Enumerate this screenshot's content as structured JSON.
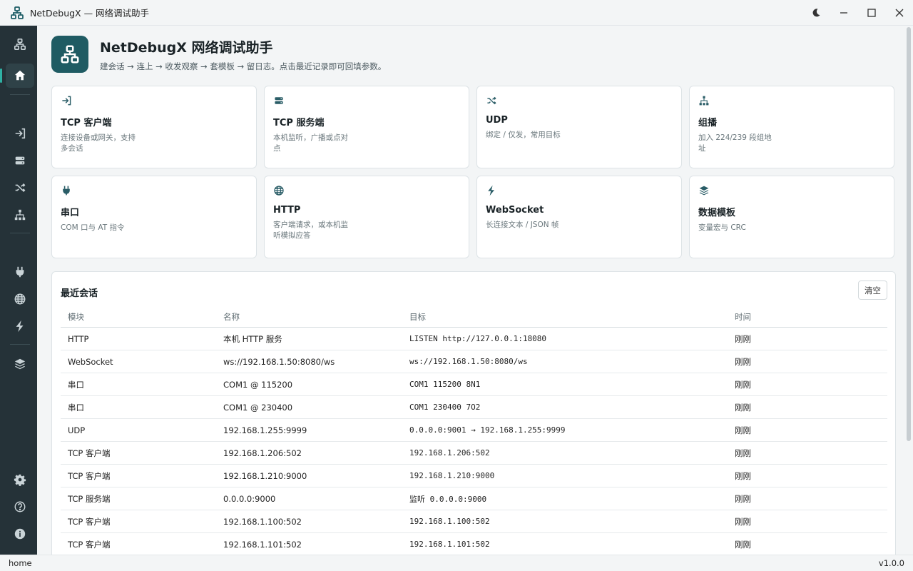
{
  "window": {
    "title": "NetDebugX — 网络调试助手"
  },
  "hero": {
    "title": "NetDebugX 网络调试助手",
    "subtitle": "建会话 → 连上 → 收发观察 → 套模板 → 留日志。点击最近记录即可回填参数。"
  },
  "cards": [
    {
      "icon": "login-arrow-icon",
      "title": "TCP 客户端",
      "desc": "连接设备或网关，支持多会话"
    },
    {
      "icon": "server-icon",
      "title": "TCP 服务端",
      "desc": "本机监听，广播或点对点"
    },
    {
      "icon": "shuffle-icon",
      "title": "UDP",
      "desc": "绑定 / 仅发，常用目标"
    },
    {
      "icon": "sitemap-icon",
      "title": "组播",
      "desc": "加入 224/239 段组地址"
    },
    {
      "icon": "plug-icon",
      "title": "串口",
      "desc": "COM 口与 AT 指令"
    },
    {
      "icon": "globe-icon",
      "title": "HTTP",
      "desc": "客户端请求，或本机监听模拟应答"
    },
    {
      "icon": "bolt-icon",
      "title": "WebSocket",
      "desc": "长连接文本 / JSON 帧"
    },
    {
      "icon": "layers-icon",
      "title": "数据模板",
      "desc": "变量宏与 CRC"
    }
  ],
  "recent": {
    "title": "最近会话",
    "clear_label": "清空",
    "columns": [
      "模块",
      "名称",
      "目标",
      "时间"
    ],
    "rows": [
      {
        "module": "HTTP",
        "name": "本机 HTTP 服务",
        "target": "LISTEN http://127.0.0.1:18080",
        "time": "刚刚"
      },
      {
        "module": "WebSocket",
        "name": "ws://192.168.1.50:8080/ws",
        "target": "ws://192.168.1.50:8080/ws",
        "time": "刚刚"
      },
      {
        "module": "串口",
        "name": "COM1 @ 115200",
        "target": "COM1 115200 8N1",
        "time": "刚刚"
      },
      {
        "module": "串口",
        "name": "COM1 @ 230400",
        "target": "COM1 230400 7O2",
        "time": "刚刚"
      },
      {
        "module": "UDP",
        "name": "192.168.1.255:9999",
        "target": "0.0.0.0:9001 → 192.168.1.255:9999",
        "time": "刚刚"
      },
      {
        "module": "TCP 客户端",
        "name": "192.168.1.206:502",
        "target": "192.168.1.206:502",
        "time": "刚刚"
      },
      {
        "module": "TCP 客户端",
        "name": "192.168.1.210:9000",
        "target": "192.168.1.210:9000",
        "time": "刚刚"
      },
      {
        "module": "TCP 服务端",
        "name": "0.0.0.0:9000",
        "target": "监听 0.0.0.0:9000",
        "time": "刚刚"
      },
      {
        "module": "TCP 客户端",
        "name": "192.168.1.100:502",
        "target": "192.168.1.100:502",
        "time": "刚刚"
      },
      {
        "module": "TCP 客户端",
        "name": "192.168.1.101:502",
        "target": "192.168.1.101:502",
        "time": "刚刚"
      }
    ]
  },
  "status": {
    "route": "home",
    "version": "v1.0.0"
  },
  "colors": {
    "sidebar": "#253238",
    "accent": "#1f5b63",
    "active_indicator": "#2fb1a4"
  }
}
